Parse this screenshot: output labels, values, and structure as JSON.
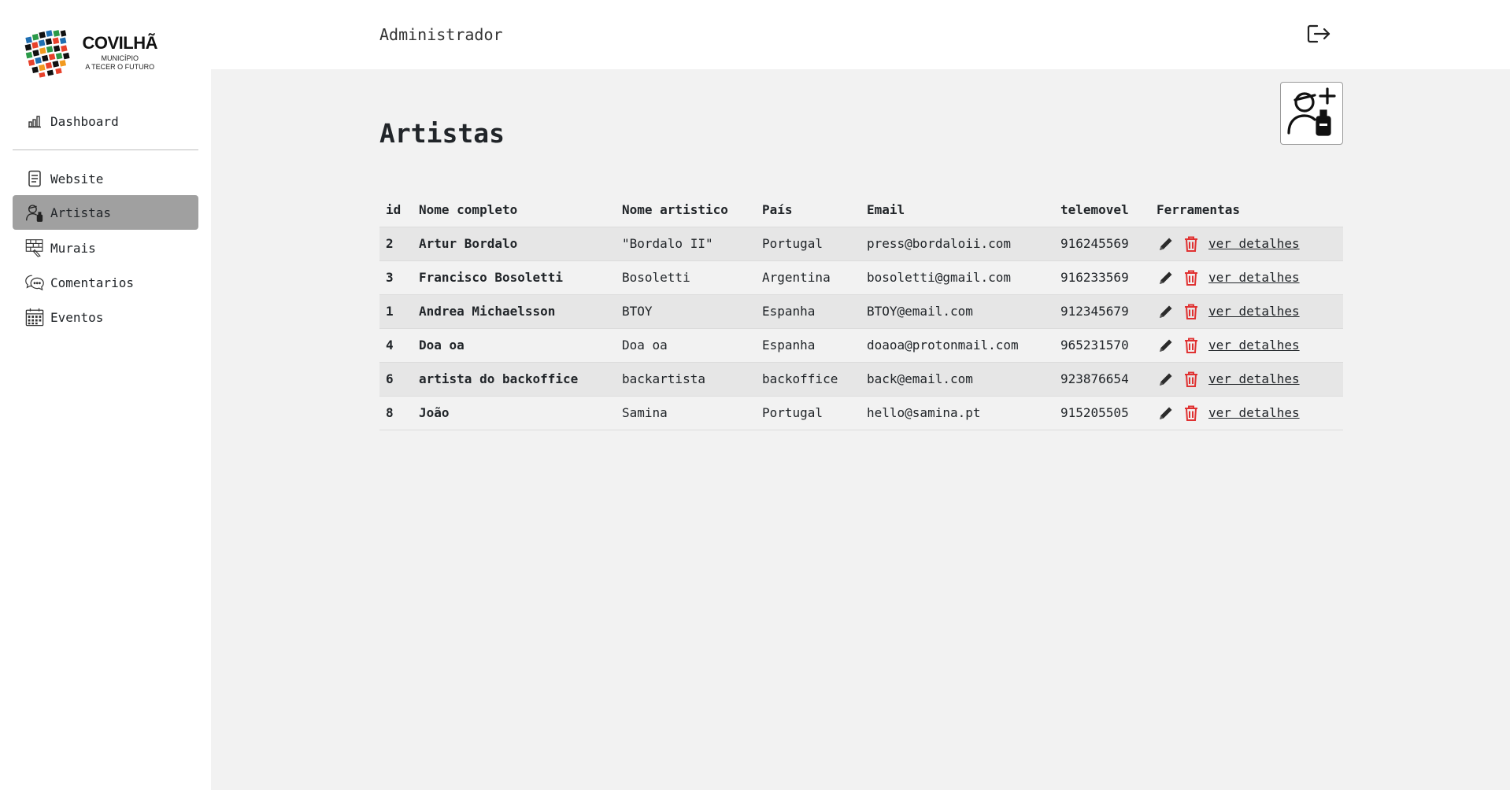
{
  "app": {
    "logo_title": "COVILHÃ",
    "logo_sub_1": "MUNICÍPIO",
    "logo_sub_2": "A TECER O FUTURO",
    "colors": {
      "active_nav": "#a0a0a0",
      "main_bg": "#f2f2f2",
      "delete_red": "#e03131"
    }
  },
  "sidebar": {
    "top_item": {
      "label": "Dashboard",
      "icon": "bar-chart-icon"
    },
    "items": [
      {
        "label": "Website",
        "icon": "document-icon",
        "active": false
      },
      {
        "label": "Artistas",
        "icon": "artist-icon",
        "active": true
      },
      {
        "label": "Murais",
        "icon": "mural-icon",
        "active": false
      },
      {
        "label": "Comentarios",
        "icon": "chat-icon",
        "active": false
      },
      {
        "label": "Eventos",
        "icon": "calendar-icon",
        "active": false
      }
    ]
  },
  "header": {
    "user_label": "Administrador",
    "logout_icon": "logout-icon"
  },
  "main": {
    "title": "Artistas",
    "add_button_icon": "add-artist-icon",
    "table": {
      "columns": [
        "id",
        "Nome completo",
        "Nome artistico",
        "País",
        "Email",
        "telemovel",
        "Ferramentas"
      ],
      "details_label": "ver detalhes",
      "rows": [
        {
          "id": "2",
          "name": "Artur Bordalo",
          "artistic": "\"Bordalo II\"",
          "country": "Portugal",
          "email": "press@bordaloii.com",
          "phone": "916245569"
        },
        {
          "id": "3",
          "name": "Francisco Bosoletti",
          "artistic": "Bosoletti",
          "country": "Argentina",
          "email": "bosoletti@gmail.com",
          "phone": "916233569"
        },
        {
          "id": "1",
          "name": "Andrea Michaelsson",
          "artistic": "BTOY",
          "country": "Espanha",
          "email": "BTOY@email.com",
          "phone": "912345679"
        },
        {
          "id": "4",
          "name": "Doa oa",
          "artistic": "Doa oa",
          "country": "Espanha",
          "email": "doaoa@protonmail.com",
          "phone": "965231570"
        },
        {
          "id": "6",
          "name": "artista do backoffice",
          "artistic": "backartista",
          "country": "backoffice",
          "email": "back@email.com",
          "phone": "923876654"
        },
        {
          "id": "8",
          "name": "João",
          "artistic": "Samina",
          "country": "Portugal",
          "email": "hello@samina.pt",
          "phone": "915205505"
        }
      ]
    }
  }
}
